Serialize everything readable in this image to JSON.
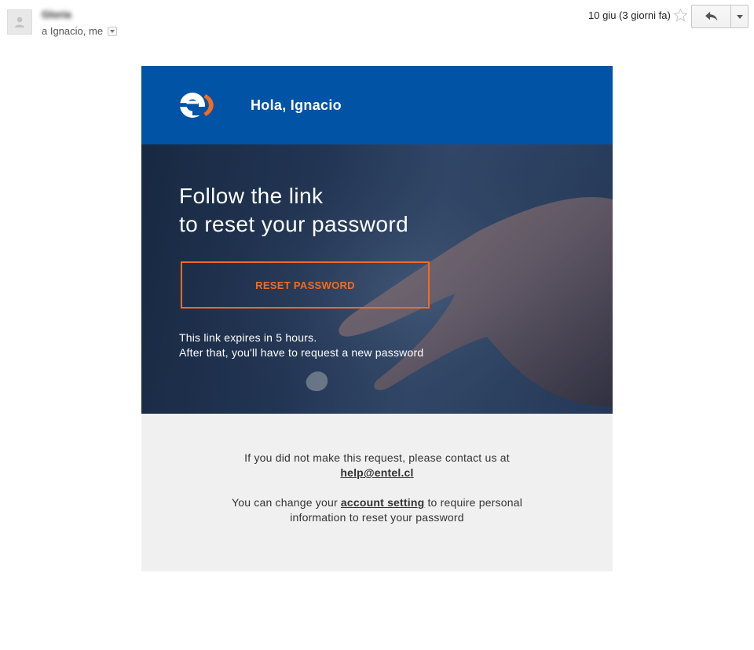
{
  "header": {
    "sender_name": "Gloria",
    "recipients": "a Ignacio, me",
    "date": "10 giu (3 giorni fa)"
  },
  "email": {
    "greeting": "Hola, Ignacio",
    "hero": {
      "title_line1": "Follow the link",
      "title_line2": "to reset your password",
      "button_label": "RESET PASSWORD",
      "expire_line1": "This link expires in 5 hours.",
      "expire_line2": "After that, you'll have to request a new password"
    },
    "footer": {
      "line1": "If you did not make this request, please contact us at",
      "email_link": "help@entel.cl",
      "line2_prefix": "You can change your",
      "account_link": "account setting",
      "line2_suffix": "to require personal",
      "line3": "information to reset your password"
    }
  },
  "colors": {
    "brand_blue": "#0153a6",
    "accent_orange": "#f26c21",
    "footer_bg": "#f0f0f0"
  },
  "icons": {
    "avatar": "person-icon",
    "details": "chevron-down-icon",
    "star": "star-icon",
    "reply": "reply-icon",
    "more": "dropdown-arrow-icon",
    "logo": "entel-logo"
  }
}
